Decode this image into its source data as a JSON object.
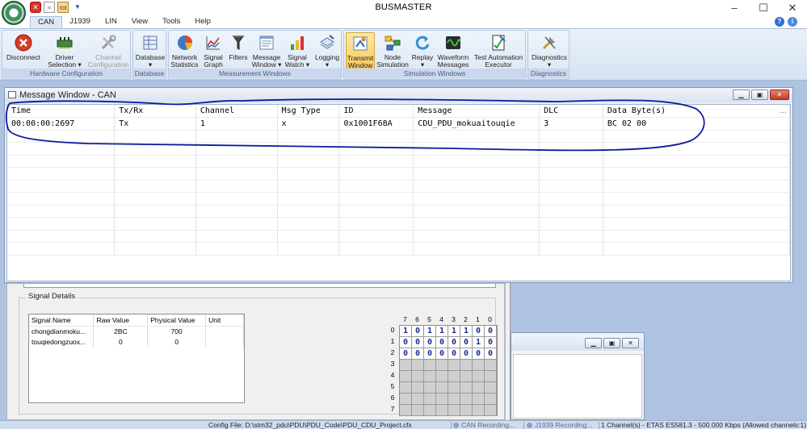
{
  "app": {
    "title": "BUSMASTER"
  },
  "window_controls": {
    "minimize": "–",
    "maximize": "☐",
    "close": "✕"
  },
  "menu": {
    "tabs": [
      "CAN",
      "J1939",
      "LIN",
      "View",
      "Tools",
      "Help"
    ]
  },
  "ribbon": {
    "groups": [
      {
        "label": "Hardware Configuration",
        "buttons": [
          {
            "line1": "Disconnect",
            "line2": ""
          },
          {
            "line1": "Driver",
            "line2": "Selection ▾"
          },
          {
            "line1": "Channel",
            "line2": "Configuration"
          }
        ]
      },
      {
        "label": "Database",
        "buttons": [
          {
            "line1": "Database",
            "line2": "▾"
          }
        ]
      },
      {
        "label": "Measurement Windows",
        "buttons": [
          {
            "line1": "Network",
            "line2": "Statistics"
          },
          {
            "line1": "Signal",
            "line2": "Graph ▾"
          },
          {
            "line1": "Filters",
            "line2": ""
          },
          {
            "line1": "Message",
            "line2": "Window ▾"
          },
          {
            "line1": "Signal",
            "line2": "Watch ▾"
          },
          {
            "line1": "Logging",
            "line2": "▾"
          }
        ]
      },
      {
        "label": "Simulation Windows",
        "buttons": [
          {
            "line1": "Transmit",
            "line2": "Window"
          },
          {
            "line1": "Node",
            "line2": "Simulation"
          },
          {
            "line1": "Replay",
            "line2": "▾"
          },
          {
            "line1": "Waveform",
            "line2": "Messages ▾"
          },
          {
            "line1": "Test Automation",
            "line2": "Executor"
          }
        ]
      },
      {
        "label": "Diagnostics",
        "buttons": [
          {
            "line1": "Diagnostics",
            "line2": "▾"
          }
        ]
      }
    ]
  },
  "message_window": {
    "title": "Message Window - CAN",
    "more": "...",
    "columns": [
      "Time",
      "Tx/Rx",
      "Channel",
      "Msg Type",
      "ID",
      "Message",
      "DLC",
      "Data Byte(s)"
    ],
    "rows": [
      [
        "00:00:00:2697",
        "Tx",
        "1",
        "x",
        "0x1001F68A",
        "CDU_PDU_mokuaitouqie",
        "3",
        "BC 02 00"
      ]
    ]
  },
  "signal_details": {
    "label": "Signal Details",
    "columns": [
      "Signal Name",
      "Raw Value",
      "Physical Value",
      "Unit"
    ],
    "rows": [
      [
        "chongdianmoku...",
        "2BC",
        "700",
        ""
      ],
      [
        "touqiedongzuox...",
        "0",
        "0",
        ""
      ]
    ]
  },
  "bit_matrix": {
    "col_labels": [
      "7",
      "6",
      "5",
      "4",
      "3",
      "2",
      "1",
      "0"
    ],
    "row_labels": [
      "0",
      "1",
      "2",
      "3",
      "4",
      "5",
      "6",
      "7"
    ],
    "rows": [
      [
        "1",
        "0",
        "1",
        "1",
        "1",
        "1",
        "0",
        "0"
      ],
      [
        "0",
        "0",
        "0",
        "0",
        "0",
        "0",
        "1",
        "0"
      ],
      [
        "0",
        "0",
        "0",
        "0",
        "0",
        "0",
        "0",
        "0"
      ]
    ]
  },
  "status_bar": {
    "config": "Config File: D:\\stm32_pdu\\PDU\\PDU_Code\\PDU_CDU_Project.cfx",
    "can_recording": "CAN Recording...",
    "j1939_recording": "J1939 Recording...",
    "channels": "1 Channel(s) - ETAS ES581.3 - 500.000 Kbps (Allowed channels:1)"
  },
  "colors": {
    "ribbon_active": "#f8c95b",
    "annotation": "#0b1a9e",
    "bit_text": "#1b2f8f",
    "workspace": "#aec3e2"
  }
}
